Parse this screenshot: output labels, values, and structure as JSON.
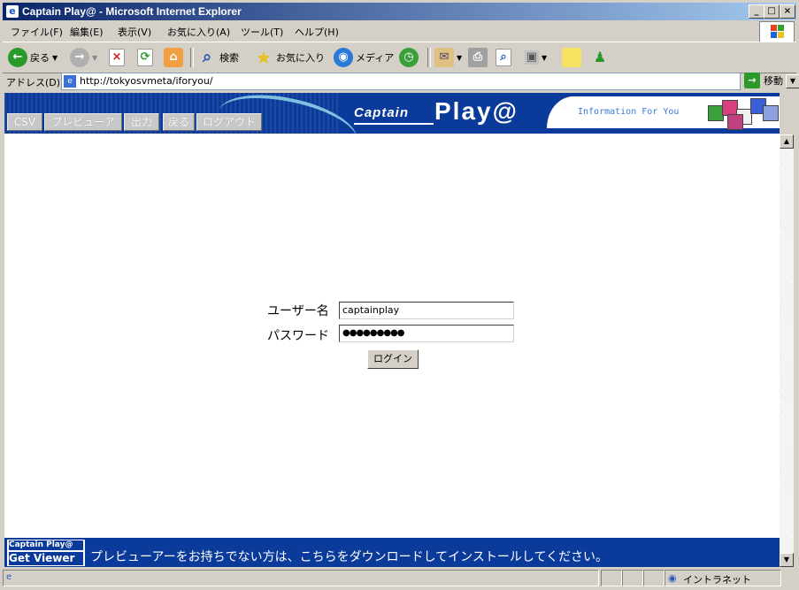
{
  "window": {
    "title": "Captain Play@ - Microsoft Internet Explorer",
    "controls": [
      "_",
      "□",
      "×"
    ]
  },
  "menu": [
    "ファイル(F)",
    "編集(E)",
    "表示(V)",
    "お気に入り(A)",
    "ツール(T)",
    "ヘルプ(H)"
  ],
  "toolbar": {
    "back": "戻る",
    "search": "検索",
    "favorites": "お気に入り",
    "media": "メディア"
  },
  "address": {
    "label": "アドレス(D)",
    "url": "http://tokyosvmeta/iforyou/",
    "go": "移動"
  },
  "banner": {
    "captain": "Captain",
    "play": "Play@",
    "tagline": "Information For You",
    "nav": [
      "CSV",
      "プレビューア",
      "出力",
      "戻る",
      "ログアウト"
    ]
  },
  "login": {
    "username_label": "ユーザー名",
    "username_value": "captainplay",
    "password_label": "パスワード",
    "password_value": "●●●●●●●●●",
    "button": "ログイン"
  },
  "footer": {
    "logo_top": "Captain Play@",
    "logo_bottom": "Get Viewer",
    "message": "プレビューアーをお持ちでない方は、こちらをダウンロードしてインストールしてください。"
  },
  "status": {
    "zone": "イントラネット"
  }
}
